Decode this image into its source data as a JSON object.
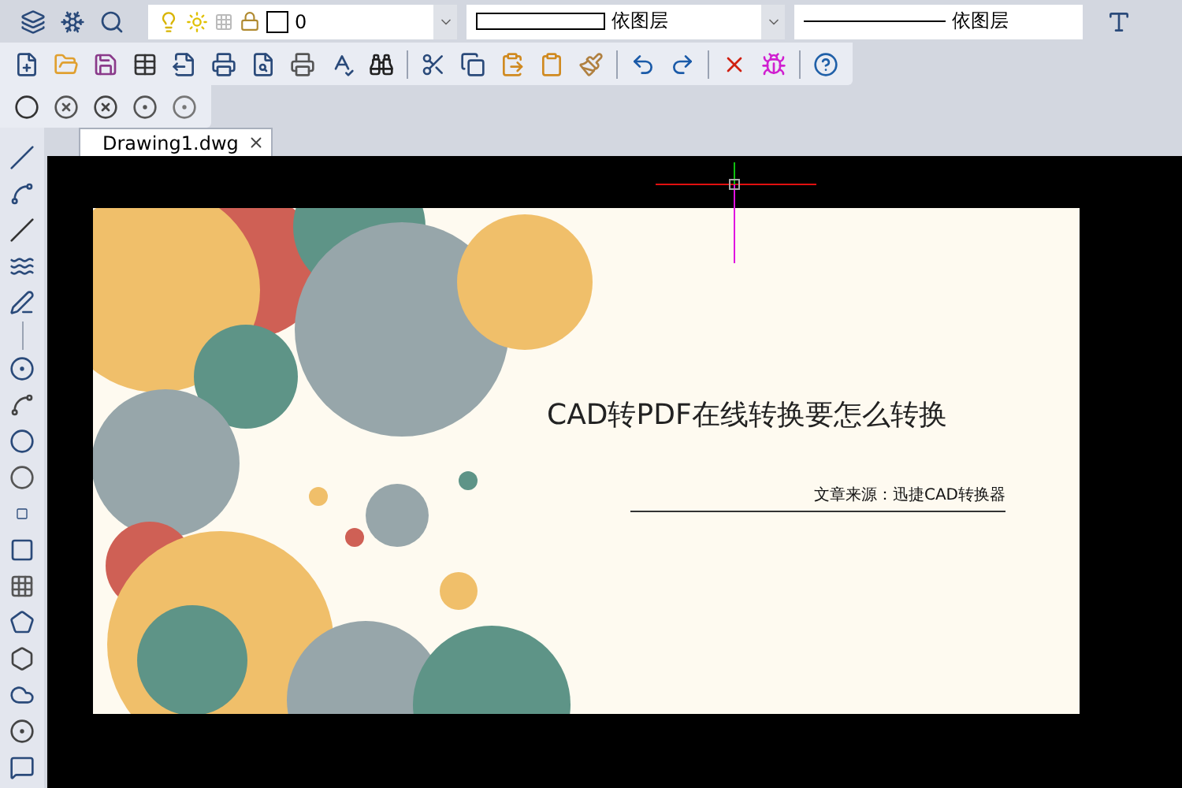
{
  "layer_bar": {
    "layer_name": "0",
    "color_setting": "依图层",
    "linetype": "依图层"
  },
  "tabs": [
    {
      "label": "Drawing1.dwg",
      "selected": true
    }
  ],
  "drawing": {
    "title": "CAD转PDF在线转换要怎么转换",
    "source": "文章来源：迅捷CAD转换器"
  }
}
